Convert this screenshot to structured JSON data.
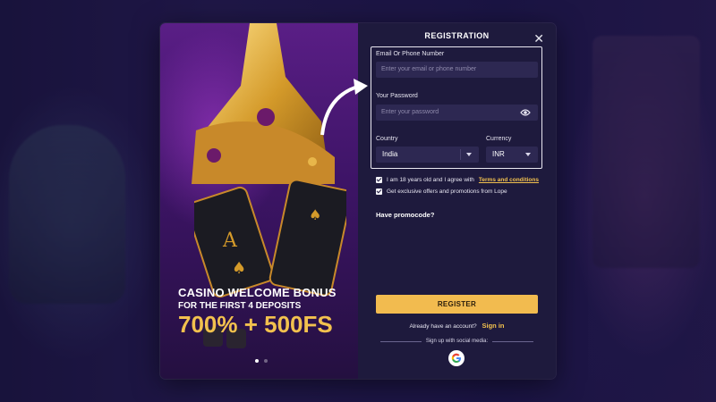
{
  "registration": {
    "title": "REGISTRATION",
    "email": {
      "label": "Email Or Phone Number",
      "placeholder": "Enter your email or phone number"
    },
    "password": {
      "label": "Your Password",
      "placeholder": "Enter your password"
    },
    "country": {
      "label": "Country",
      "value": "India"
    },
    "currency": {
      "label": "Currency",
      "value": "INR"
    },
    "agree": {
      "text": "I am 18 years old and I agree with",
      "link": "Terms and conditions",
      "checked": true
    },
    "offers": {
      "text": "Get exclusive offers and promotions from Lope",
      "checked": true
    },
    "promocode_label": "Have promocode?",
    "register_button": "REGISTER",
    "account_prompt": "Already have an account?",
    "signin_link": "Sign in",
    "social_label": "Sign up with social media:",
    "social_icon": "google-icon"
  },
  "promo": {
    "title": "CASINO WELCOME BONUS",
    "subtitle": "FOR THE FIRST 4 DEPOSITS",
    "amount": "700% + 500FS",
    "slides_total": 2,
    "active_slide": 1
  },
  "colors": {
    "accent": "#f2bb4f",
    "panel": "#1e1a3d",
    "input": "#2d2852",
    "promo_purple": "#5a1e86"
  }
}
